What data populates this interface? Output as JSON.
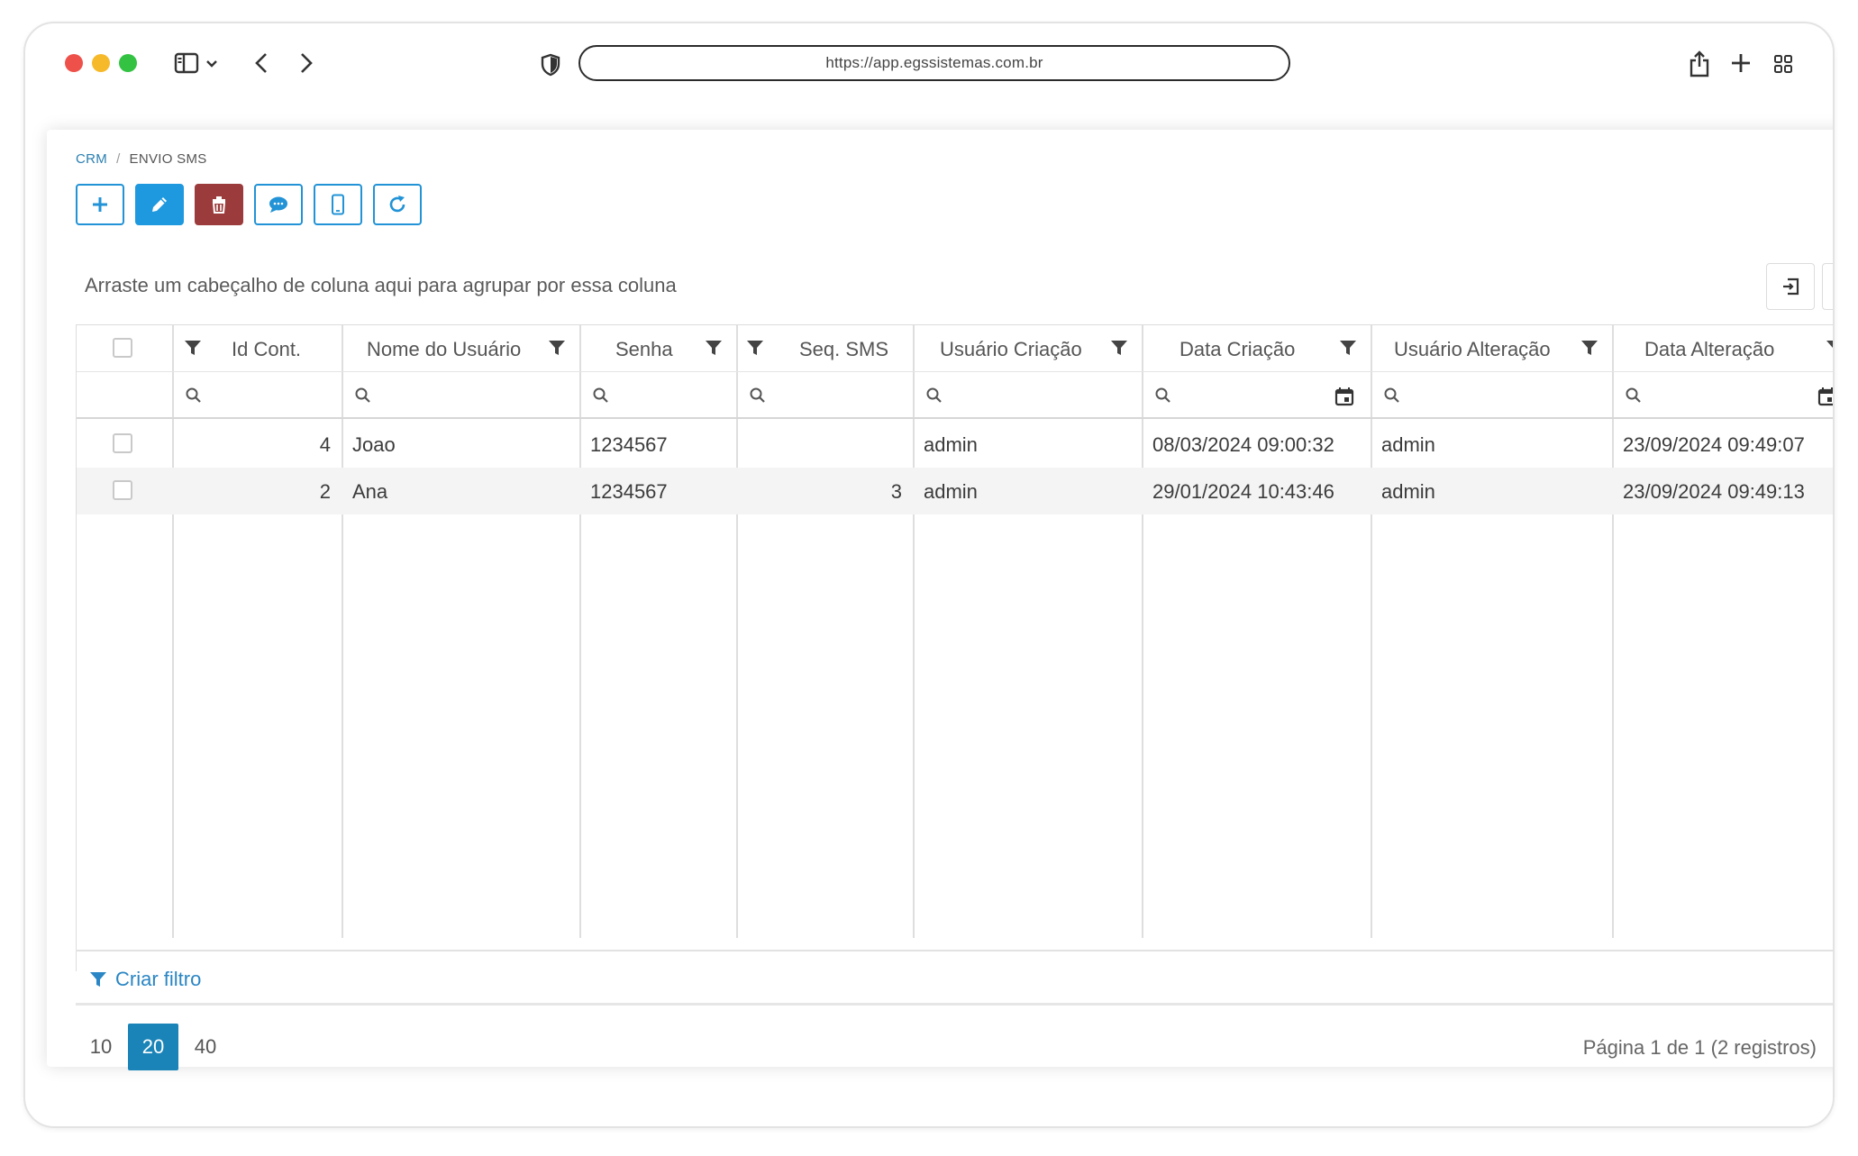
{
  "browser": {
    "url": "https://app.egssistemas.com.br"
  },
  "breadcrumb": {
    "root": "CRM",
    "separator": "/",
    "current": "ENVIO SMS"
  },
  "toolbar": {
    "buttons": [
      "plus-icon",
      "pencil-icon",
      "trash-icon",
      "chat-icon",
      "mobile-icon",
      "refresh-icon"
    ]
  },
  "grid": {
    "group_hint": "Arraste um cabeçalho de coluna aqui para agrupar por essa coluna",
    "columns": [
      "Id Cont.",
      "Nome do Usuário",
      "Senha",
      "Seq. SMS",
      "Usuário Criação",
      "Data Criação",
      "Usuário Alteração",
      "Data Alteração"
    ],
    "rows": [
      {
        "id": "4",
        "nome": "Joao",
        "senha": "1234567",
        "seq": "",
        "usuario_criacao": "admin",
        "data_criacao": "08/03/2024 09:00:32",
        "usuario_alteracao": "admin",
        "data_alteracao": "23/09/2024 09:49:07"
      },
      {
        "id": "2",
        "nome": "Ana",
        "senha": "1234567",
        "seq": "3",
        "usuario_criacao": "admin",
        "data_criacao": "29/01/2024 10:43:46",
        "usuario_alteracao": "admin",
        "data_alteracao": "23/09/2024 09:49:13"
      }
    ],
    "criar_filtro": "Criar filtro"
  },
  "pager": {
    "sizes": [
      "10",
      "20",
      "40"
    ],
    "active_size": "20",
    "info": "Página 1 de 1 (2 registros)",
    "current_page": "1"
  },
  "colors": {
    "accent": "#1e98de",
    "danger": "#9c3b3c",
    "pager_active": "#1a84b8"
  }
}
